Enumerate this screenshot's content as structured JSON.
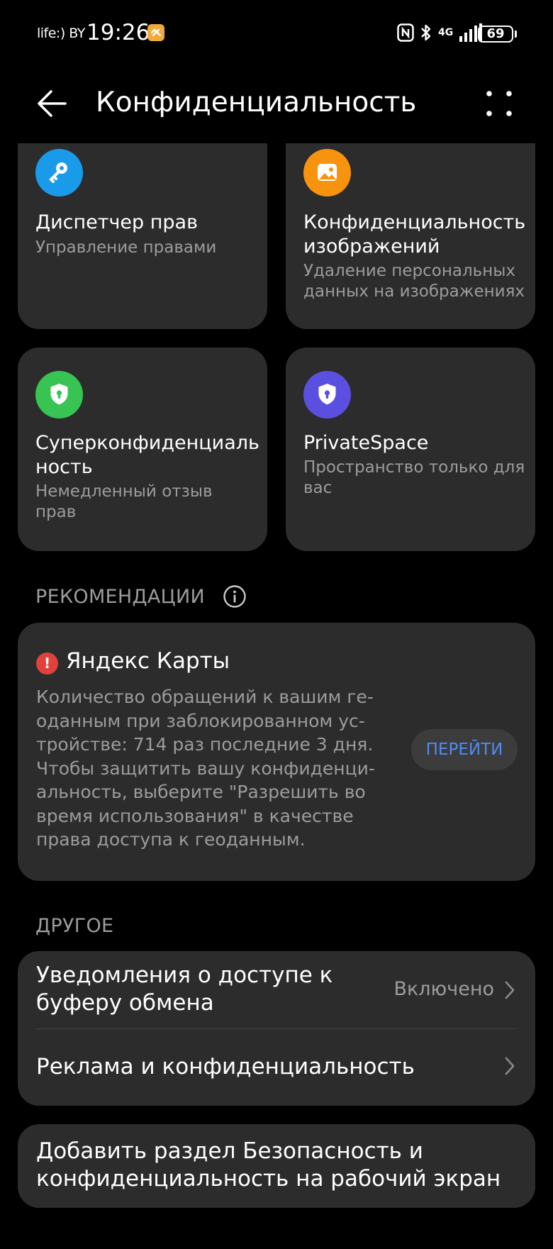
{
  "status_bar": {
    "carrier": "life:) BY",
    "time": "19:26",
    "network": "4G",
    "battery": "69"
  },
  "header": {
    "title": "Конфиденциальность"
  },
  "tiles": [
    {
      "title": "Диспетчер прав",
      "subtitle": "Управление правами",
      "icon": "key-icon",
      "color": "#1a9bea"
    },
    {
      "title": "Конфиденциальность изображений",
      "subtitle": "Удаление персональных данных на изображениях",
      "icon": "image-icon",
      "color": "#f7930f"
    },
    {
      "title": "Суперконфиденциаль\nность",
      "subtitle": "Немедленный отзыв прав",
      "icon": "shield-lock-icon",
      "color": "#38c452"
    },
    {
      "title": "PrivateSpace",
      "subtitle": "Пространство только для вас",
      "icon": "shield-lock-icon",
      "color": "#5b4fe0"
    }
  ],
  "recommendations": {
    "label": "РЕКОМЕНДАЦИИ",
    "app": "Яндекс Карты",
    "text": "Количество обращений к вашим ге-\nоданным при заблокированном ус-\nтройстве: 714 раз последние 3 дня.\nЧтобы защитить вашу конфиденци-\nальность, выберите \"Разрешить во\nвремя использования\" в качестве\nправа доступа к геоданным.",
    "button": "ПЕРЕЙТИ",
    "alert_color": "#e0423b",
    "button_color": "#4f8cf2"
  },
  "other": {
    "label": "ДРУГОЕ",
    "items": [
      {
        "title": "Уведомления о доступе к\nбуферу обмена",
        "value": "Включено"
      },
      {
        "title": "Реклама и конфиденциальность",
        "value": ""
      }
    ]
  },
  "add_section": {
    "text": "Добавить раздел Безопасность и\nконфиденциальность на рабочий экран"
  }
}
